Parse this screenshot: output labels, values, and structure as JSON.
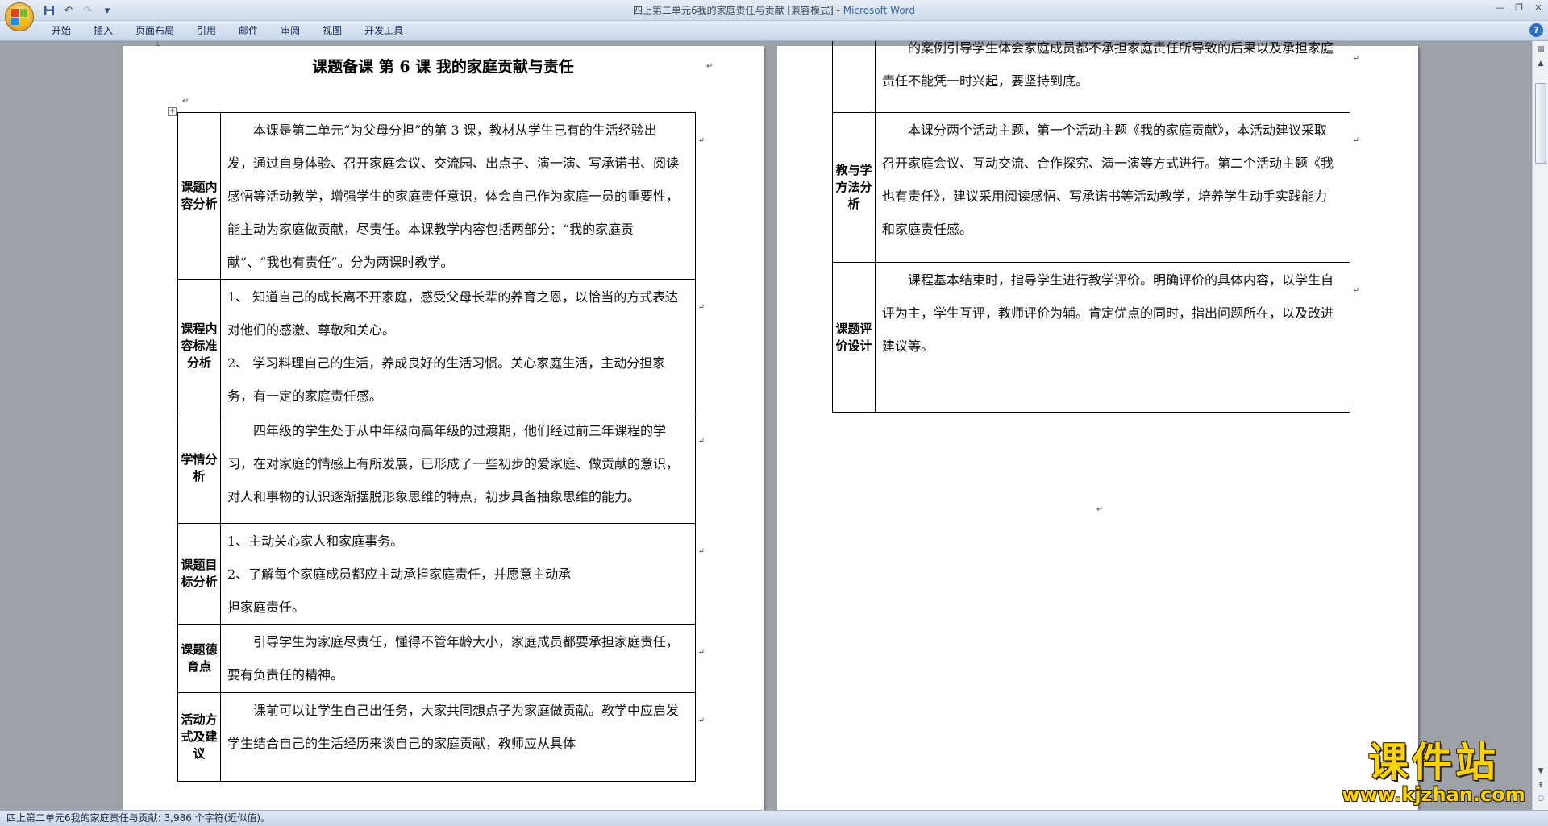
{
  "window": {
    "title_doc": "四上第二单元6我的家庭责任与贡献 [兼容模式]",
    "title_sep": " - ",
    "title_app": "Microsoft Word"
  },
  "quick_access": {
    "undo_label": "↶",
    "redo_label": "↷",
    "dropdown_label": "▾"
  },
  "ribbon": {
    "tabs": [
      "开始",
      "插入",
      "页面布局",
      "引用",
      "邮件",
      "审阅",
      "视图",
      "开发工具"
    ]
  },
  "document": {
    "title": "课题备课   第 6 课   我的家庭贡献与责任",
    "left_rows": [
      {
        "label": "课题内容分析",
        "paragraphs": [
          "本课是第二单元“为父母分担”的第 3 课，教材从学生已有的生活经验出发，通过自身体验、召开家庭会议、交流园、出点子、演一演、写承诺书、阅读感悟等活动教学，增强学生的家庭责任意识，体会自己作为家庭一员的重要性，能主动为家庭做贡献，尽责任。本课教学内容包括两部分：“我的家庭贡献”、“我也有责任”。分为两课时教学。"
        ]
      },
      {
        "label": "课程内容标准分析",
        "paragraphs": [
          "1、  知道自己的成长离不开家庭，感受父母长辈的养育之恩，以恰当的方式表达对他们的感激、尊敬和关心。",
          "2、  学习料理自己的生活，养成良好的生活习惯。关心家庭生活，主动分担家务，有一定的家庭责任感。"
        ]
      },
      {
        "label": "学情分析",
        "paragraphs": [
          "四年级的学生处于从中年级向高年级的过渡期，他们经过前三年课程的学习，在对家庭的情感上有所发展，已形成了一些初步的爱家庭、做贡献的意识，对人和事物的认识逐渐摆脱形象思维的特点，初步具备抽象思维的能力。"
        ]
      },
      {
        "label": "课题目标分析",
        "paragraphs": [
          "1、主动关心家人和家庭事务。",
          "2、了解每个家庭成员都应主动承担家庭责任，并愿意主动承",
          "担家庭责任。"
        ]
      },
      {
        "label": "课题德育点",
        "paragraphs": [
          "引导学生为家庭尽责任，懂得不管年龄大小，家庭成员都要承担家庭责任，要有负责任的精神。"
        ]
      },
      {
        "label": "活动方式及建议",
        "paragraphs": [
          "课前可以让学生自己出任务，大家共同想点子为家庭做贡献。教学中应启发学生结合自己的生活经历来谈自己的家庭贡献，教师应从具体"
        ]
      }
    ],
    "right_rows": [
      {
        "label": "",
        "paragraphs": [
          "的案例引导学生体会家庭成员都不承担家庭责任所导致的后果以及承担家庭责任不能凭一时兴起，要坚持到底。"
        ]
      },
      {
        "label": "教与学方法分析",
        "paragraphs": [
          "本课分两个活动主题，第一个活动主题《我的家庭贡献》，本活动建议采取召开家庭会议、互动交流、合作探究、演一演等方式进行。第二个活动主题《我也有责任》，建议采用阅读感悟、写承诺书等活动教学，培养学生动手实践能力和家庭责任感。"
        ]
      },
      {
        "label": "课题评价设计",
        "paragraphs": [
          "课程基本结束时，指导学生进行教学评价。明确评价的具体内容，以学生自评为主，学生互评，教师评价为辅。肯定优点的同时，指出问题所在，以及改进建议等。"
        ]
      }
    ]
  },
  "status": {
    "text": "四上第二单元6我的家庭责任与贡献: 3,986 个字符(近似值)。"
  },
  "watermark": {
    "main": "课件站",
    "url": "www.kjzhan.com"
  },
  "icons": {
    "office": "office-button-icon",
    "save": "save-icon",
    "help": "help-icon",
    "table_move": "table-move-handle-icon",
    "paragraph_mark": "↵"
  }
}
